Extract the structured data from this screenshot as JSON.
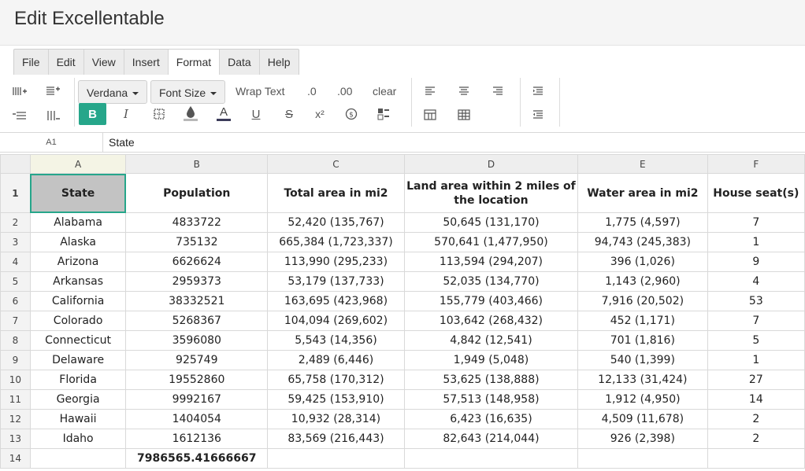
{
  "app": {
    "title": "Edit Excellentable"
  },
  "menu": [
    "File",
    "Edit",
    "View",
    "Insert",
    "Format",
    "Data",
    "Help"
  ],
  "menu_active": "Format",
  "toolbar": {
    "font_family": "Verdana",
    "font_size": "Font Size",
    "wrap_text": "Wrap Text",
    "decimal_one": ".0",
    "decimal_two": ".00",
    "clear": "clear",
    "bold": "B",
    "italic": "I",
    "strike": "S",
    "underline": "U",
    "font_color": "A",
    "superscript": "x²",
    "accent_color": "#26a68a"
  },
  "formula": {
    "cell_ref": "A1",
    "value": "State"
  },
  "columns": [
    "A",
    "B",
    "C",
    "D",
    "E",
    "F"
  ],
  "header_row": {
    "num": "1",
    "cells": [
      "State",
      "Population",
      "Total area in mi2",
      "Land area within 2 miles of the location",
      "Water area in mi2",
      "House seat(s)"
    ]
  },
  "rows": [
    {
      "num": "2",
      "cells": [
        "Alabama",
        "4833722",
        "52,420 (135,767)",
        "50,645 (131,170)",
        "1,775 (4,597)",
        "7"
      ]
    },
    {
      "num": "3",
      "cells": [
        "Alaska",
        "735132",
        "665,384 (1,723,337)",
        "570,641 (1,477,950)",
        "94,743 (245,383)",
        "1"
      ]
    },
    {
      "num": "4",
      "cells": [
        "Arizona",
        "6626624",
        "113,990 (295,233)",
        "113,594 (294,207)",
        "396 (1,026)",
        "9"
      ]
    },
    {
      "num": "5",
      "cells": [
        "Arkansas",
        "2959373",
        "53,179 (137,733)",
        "52,035 (134,770)",
        "1,143 (2,960)",
        "4"
      ]
    },
    {
      "num": "6",
      "cells": [
        "California",
        "38332521",
        "163,695 (423,968)",
        "155,779 (403,466)",
        "7,916 (20,502)",
        "53"
      ]
    },
    {
      "num": "7",
      "cells": [
        "Colorado",
        "5268367",
        "104,094 (269,602)",
        "103,642 (268,432)",
        "452 (1,171)",
        "7"
      ]
    },
    {
      "num": "8",
      "cells": [
        "Connecticut",
        "3596080",
        "5,543 (14,356)",
        "4,842 (12,541)",
        "701 (1,816)",
        "5"
      ]
    },
    {
      "num": "9",
      "cells": [
        "Delaware",
        "925749",
        "2,489 (6,446)",
        "1,949 (5,048)",
        "540 (1,399)",
        "1"
      ]
    },
    {
      "num": "10",
      "cells": [
        "Florida",
        "19552860",
        "65,758 (170,312)",
        "53,625 (138,888)",
        "12,133 (31,424)",
        "27"
      ]
    },
    {
      "num": "11",
      "cells": [
        "Georgia",
        "9992167",
        "59,425 (153,910)",
        "57,513 (148,958)",
        "1,912 (4,950)",
        "14"
      ]
    },
    {
      "num": "12",
      "cells": [
        "Hawaii",
        "1404054",
        "10,932 (28,314)",
        "6,423 (16,635)",
        "4,509 (11,678)",
        "2"
      ]
    },
    {
      "num": "13",
      "cells": [
        "Idaho",
        "1612136",
        "83,569 (216,443)",
        "82,643 (214,044)",
        "926 (2,398)",
        "2"
      ]
    }
  ],
  "sum_row": {
    "num": "14",
    "value": "7986565.41666667"
  }
}
